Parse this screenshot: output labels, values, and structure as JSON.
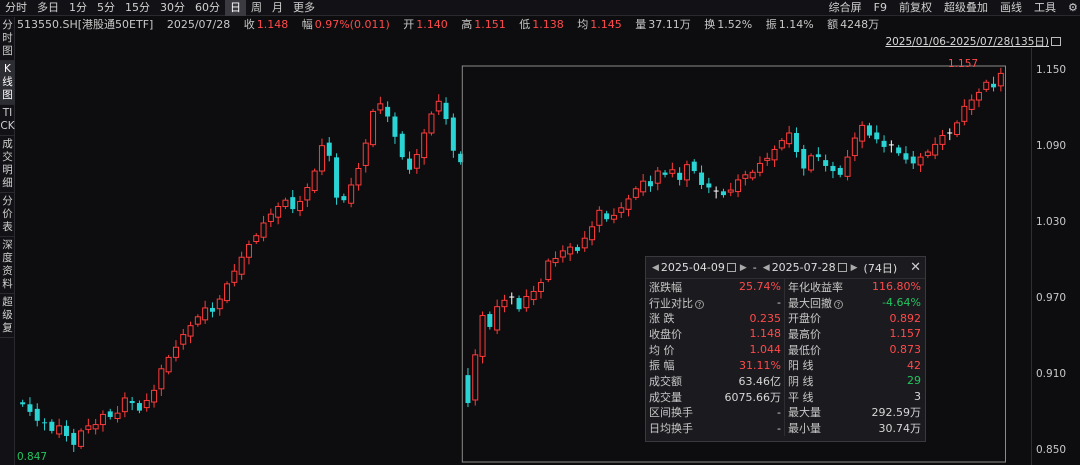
{
  "toolbar": {
    "tabs": [
      "分时",
      "多日",
      "1分",
      "5分",
      "15分",
      "30分",
      "60分",
      "日",
      "周",
      "月",
      "更多"
    ],
    "active_tab": "日",
    "right": [
      "综合屏",
      "F9",
      "前复权",
      "超级叠加",
      "画线",
      "工具"
    ]
  },
  "sidebar": [
    "分时图",
    "K线图",
    "TICK",
    "成交明细",
    "分价表",
    "深度资料",
    "超级复"
  ],
  "quote": {
    "code": "513550.SH[港股通50ETF]",
    "date": "2025/07/28",
    "close_label": "收",
    "close": "1.148",
    "change_label": "幅",
    "change": "0.97%(0.011)",
    "open_label": "开",
    "open": "1.140",
    "high_label": "高",
    "high": "1.151",
    "low_label": "低",
    "low": "1.138",
    "avg_label": "均",
    "avg": "1.145",
    "vol_label": "量",
    "vol": "37.11万",
    "turn_label": "换",
    "turn": "1.52%",
    "amp_label": "振",
    "amp": "1.14%",
    "amt_label": "额",
    "amt": "4248万"
  },
  "range_label": "2025/01/06-2025/07/28(135日)",
  "axis": [
    "1.150",
    "1.090",
    "1.030",
    "0.970",
    "0.910",
    "0.850"
  ],
  "low_marker": "0.847",
  "high_marker": "1.157",
  "popup": {
    "start": "2025-04-09",
    "end": "2025-07-28",
    "sep": "-",
    "days": "(74日)",
    "rows": [
      [
        "涨跌幅",
        "25.74%",
        "red",
        "年化收益率",
        "116.80%",
        "red"
      ],
      [
        "行业对比",
        "-",
        "",
        "最大回撤",
        "-4.64%",
        "green"
      ],
      [
        "涨 跌",
        "0.235",
        "red",
        "开盘价",
        "0.892",
        "red"
      ],
      [
        "收盘价",
        "1.148",
        "red",
        "最高价",
        "1.157",
        "red"
      ],
      [
        "均 价",
        "1.044",
        "red",
        "最低价",
        "0.873",
        "red"
      ],
      [
        "振 幅",
        "31.11%",
        "red",
        "阳 线",
        "42",
        "red"
      ],
      [
        "成交额",
        "63.46亿",
        "",
        "阴 线",
        "29",
        "green"
      ],
      [
        "成交量",
        "6075.66万",
        "",
        "平 线",
        "3",
        ""
      ],
      [
        "区间换手",
        "-",
        "",
        "最大量",
        "292.59万",
        ""
      ],
      [
        "日均换手",
        "-",
        "",
        "最小量",
        "30.74万",
        ""
      ]
    ]
  },
  "chart_data": {
    "type": "candlestick",
    "ylim": [
      0.847,
      1.157
    ],
    "y_ticks": [
      1.15,
      1.09,
      1.03,
      0.97,
      0.91,
      0.85
    ],
    "colors": {
      "up": "#ff3b3b",
      "down": "#2ad4d4",
      "doji": "#ffffff"
    },
    "selection": {
      "start_index": 61,
      "end_index": 134
    },
    "closes": [
      0.887,
      0.881,
      0.874,
      0.872,
      0.866,
      0.87,
      0.862,
      0.855,
      0.866,
      0.87,
      0.871,
      0.879,
      0.877,
      0.88,
      0.892,
      0.888,
      0.882,
      0.89,
      0.898,
      0.915,
      0.924,
      0.932,
      0.942,
      0.949,
      0.956,
      0.963,
      0.96,
      0.97,
      0.982,
      0.992,
      1.003,
      1.013,
      1.02,
      1.03,
      1.037,
      1.043,
      1.048,
      1.041,
      1.047,
      1.058,
      1.071,
      1.091,
      1.083,
      1.05,
      1.048,
      1.06,
      1.073,
      1.093,
      1.118,
      1.124,
      1.114,
      1.098,
      1.082,
      1.072,
      1.084,
      1.101,
      1.116,
      1.126,
      1.112,
      1.087,
      1.078,
      0.888,
      0.926,
      0.957,
      0.948,
      0.964,
      0.969,
      0.972,
      0.962,
      0.972,
      0.976,
      0.983,
      1.0,
      1.002,
      1.008,
      1.011,
      1.008,
      1.018,
      1.027,
      1.04,
      1.033,
      1.036,
      1.042,
      1.049,
      1.057,
      1.063,
      1.059,
      1.071,
      1.068,
      1.072,
      1.064,
      1.076,
      1.071,
      1.06,
      1.058,
      1.055,
      1.052,
      1.056,
      1.064,
      1.068,
      1.07,
      1.077,
      1.081,
      1.088,
      1.095,
      1.101,
      1.086,
      1.073,
      1.083,
      1.082,
      1.075,
      1.071,
      1.068,
      1.082,
      1.097,
      1.107,
      1.099,
      1.096,
      1.09,
      1.092,
      1.085,
      1.08,
      1.077,
      1.082,
      1.086,
      1.092,
      1.099,
      1.101,
      1.109,
      1.122,
      1.127,
      1.133,
      1.141,
      1.137,
      1.148
    ]
  }
}
